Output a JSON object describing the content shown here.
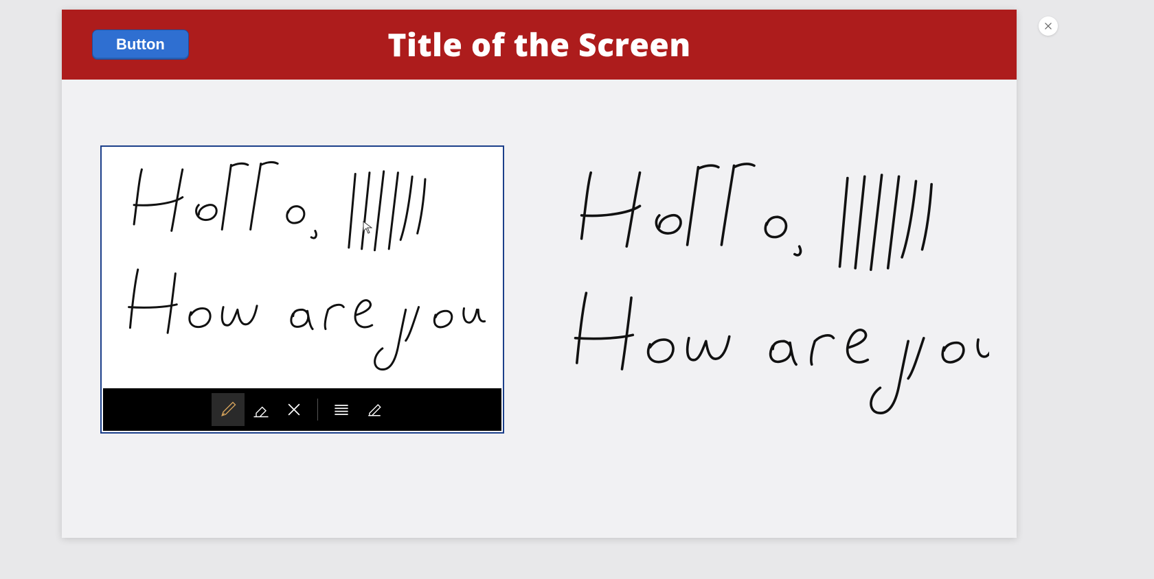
{
  "header": {
    "title": "Title of the Screen",
    "button_label": "Button"
  },
  "close": {
    "icon": "close-icon"
  },
  "signature": {
    "handwritten_text": "Hello,\nHow are you",
    "toolbar": {
      "pen": "pen",
      "eraser": "eraser",
      "clear": "clear",
      "lines": "guidelines",
      "ink_to_text": "ink-to-text",
      "selected": "pen"
    }
  },
  "preview": {
    "handwritten_text": "Hello,\nHow are you"
  },
  "colors": {
    "header_background": "#ad1c1c",
    "header_button": "#2f6fd1",
    "panel_background": "#f1f1f3",
    "pad_border": "#1b3f8a",
    "toolbar_background": "#000000",
    "pen_selected": "#d4a25a"
  }
}
